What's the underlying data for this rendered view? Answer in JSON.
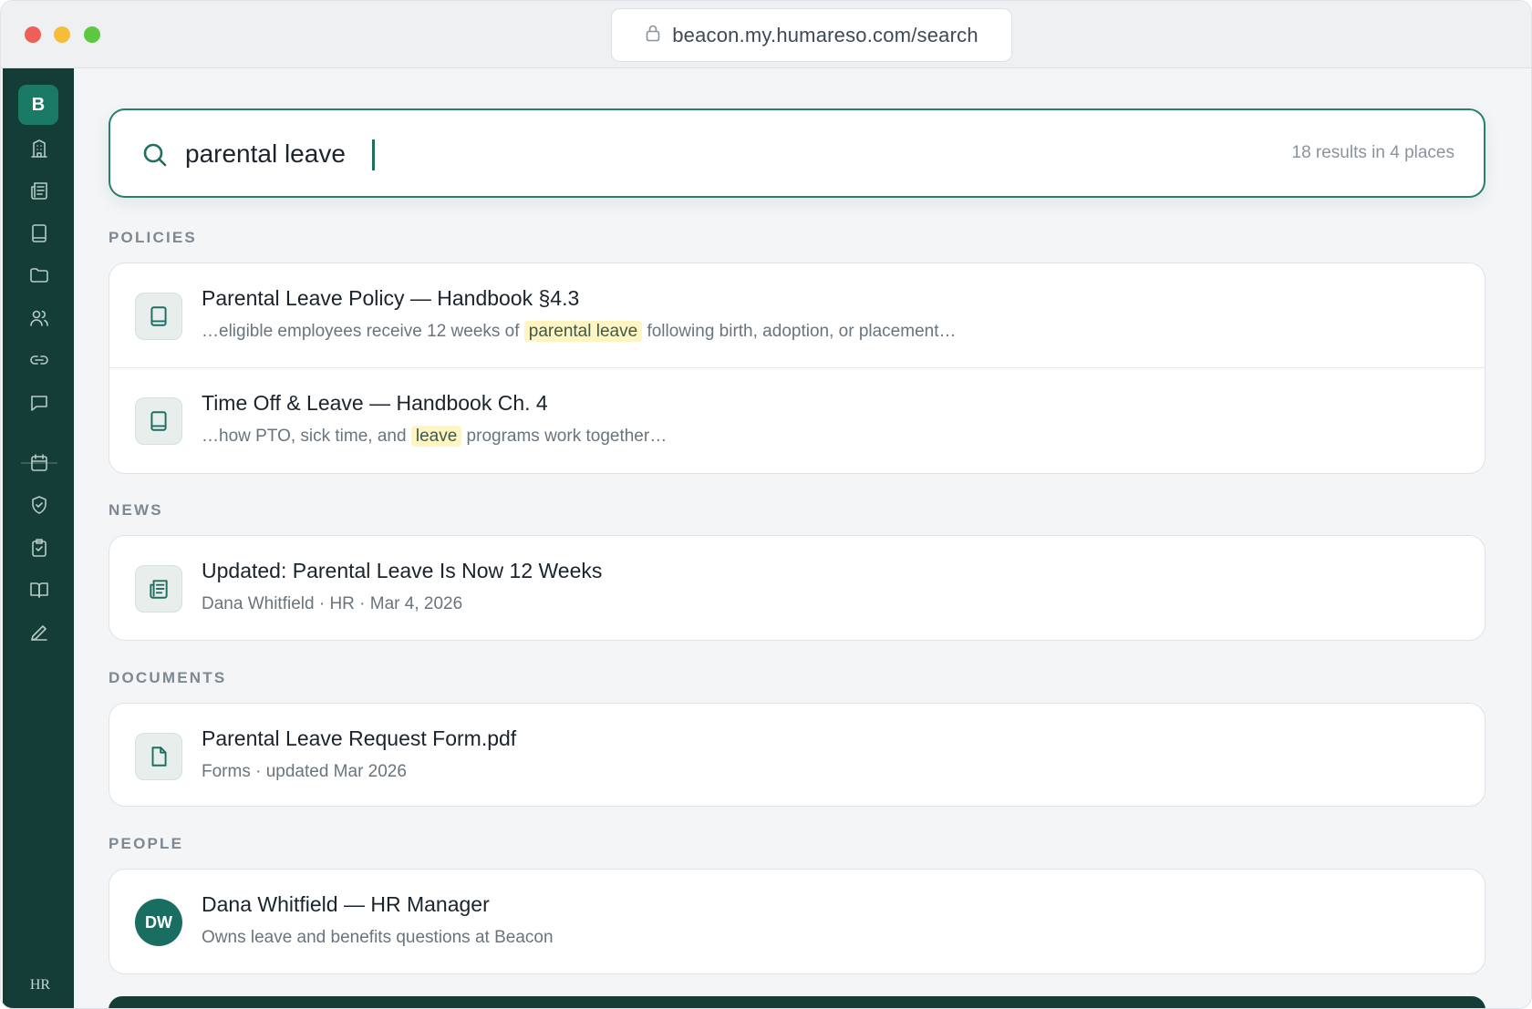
{
  "browser": {
    "url": "beacon.my.humareso.com/search"
  },
  "sidebar": {
    "logo": "B",
    "items": [
      {
        "icon": "building-icon"
      },
      {
        "icon": "newspaper-icon"
      },
      {
        "icon": "book-icon"
      },
      {
        "icon": "folder-icon"
      },
      {
        "icon": "people-icon"
      },
      {
        "icon": "link-icon"
      },
      {
        "icon": "chat-icon"
      },
      {
        "icon": "calendar-icon"
      },
      {
        "icon": "shield-check-icon"
      },
      {
        "icon": "clipboard-check-icon"
      },
      {
        "icon": "open-book-icon"
      },
      {
        "icon": "pen-icon"
      }
    ],
    "footer_mark": "HR"
  },
  "search": {
    "query": "parental leave",
    "result_count": "18 results in 4 places"
  },
  "sections": {
    "policies": {
      "label": "POLICIES",
      "items": [
        {
          "title": "Parental Leave Policy — Handbook §4.3",
          "snippet_before": "…eligible employees receive 12 weeks of",
          "snippet_highlight": "parental leave",
          "snippet_after": "following birth, adoption, or placement…",
          "icon": "book-icon"
        },
        {
          "title": "Time Off & Leave — Handbook Ch. 4",
          "snippet_before": "…how PTO, sick time, and",
          "snippet_highlight": "leave",
          "snippet_after": "programs work together…",
          "icon": "book-icon"
        }
      ]
    },
    "news": {
      "label": "NEWS",
      "items": [
        {
          "title": "Updated: Parental Leave Is Now 12 Weeks",
          "meta": "Dana Whitfield · HR · Mar 4, 2026",
          "icon": "newspaper-icon"
        }
      ]
    },
    "documents": {
      "label": "DOCUMENTS",
      "items": [
        {
          "title": "Parental Leave Request Form.pdf",
          "meta": "Forms · updated Mar 2026",
          "icon": "file-icon"
        }
      ]
    },
    "people": {
      "label": "PEOPLE",
      "items": [
        {
          "initials": "DW",
          "title": "Dana Whitfield — HR Manager",
          "meta": "Owns leave and benefits questions at Beacon"
        }
      ]
    }
  },
  "colors": {
    "brand": "#143d37",
    "accent": "#1f6f60",
    "highlight": "#fff5c2"
  }
}
